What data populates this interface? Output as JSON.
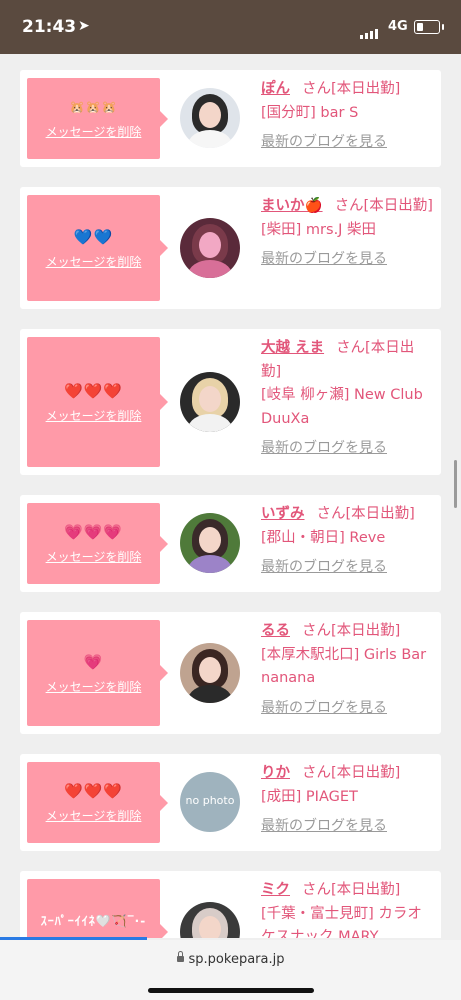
{
  "status_bar": {
    "time": "21:43",
    "network": "4G",
    "location_glyph": "➤"
  },
  "delete_label": "メッセージを削除",
  "blog_label": "最新のブログを見る",
  "san": "さん",
  "entries": [
    {
      "emoji": "🐹🐹🐹",
      "emoji_style": "hamster",
      "name": "ぽん",
      "suffix": "さん[本日出勤]",
      "shop": "[国分町] bar S",
      "avatar": "woman-white-dress"
    },
    {
      "emoji": "💙💙",
      "emoji_style": "blue",
      "name": "まいか🍎",
      "suffix": "さん[本日出勤]",
      "shop": "[柴田] mrs.J 柴田",
      "avatar": "pink-filter"
    },
    {
      "emoji": "❤️❤️❤️",
      "emoji_style": "red",
      "name": "大越 えま",
      "suffix": "さん[本日出勤]",
      "shop": "[岐阜 柳ヶ瀬] New Club DuuXa",
      "avatar": "blonde"
    },
    {
      "emoji": "💗💗💗",
      "emoji_style": "pink",
      "name": "いずみ",
      "suffix": "さん[本日出勤]",
      "shop": "[郡山・朝日] Reve",
      "avatar": "flowers"
    },
    {
      "emoji": "💗",
      "emoji_style": "pink",
      "name": "るる",
      "suffix": "さん[本日出勤]",
      "shop": "[本厚木駅北口] Girls Bar nanana",
      "avatar": "cat-ears"
    },
    {
      "emoji": "❤️❤️❤️",
      "emoji_style": "red",
      "name": "りか",
      "suffix": "さん[本日出勤]",
      "shop": "[成田] PIAGET",
      "avatar": "no-photo"
    },
    {
      "emoji": "ｽｰﾊﾟｰｲｲﾈ🤍🏹‾·-",
      "emoji_style": "text",
      "name": "ミク",
      "suffix": "さん[本日出勤]",
      "shop": "[千葉・富士見町] カラオケスナック MARY",
      "avatar": "silver-hair"
    }
  ],
  "avatar_no_photo": "no photo",
  "browser": {
    "url": "sp.pokepara.jp"
  },
  "colors": {
    "accent": "#e2567a",
    "bubble": "#ff9aa8",
    "status_bar": "#5a4a3f"
  }
}
